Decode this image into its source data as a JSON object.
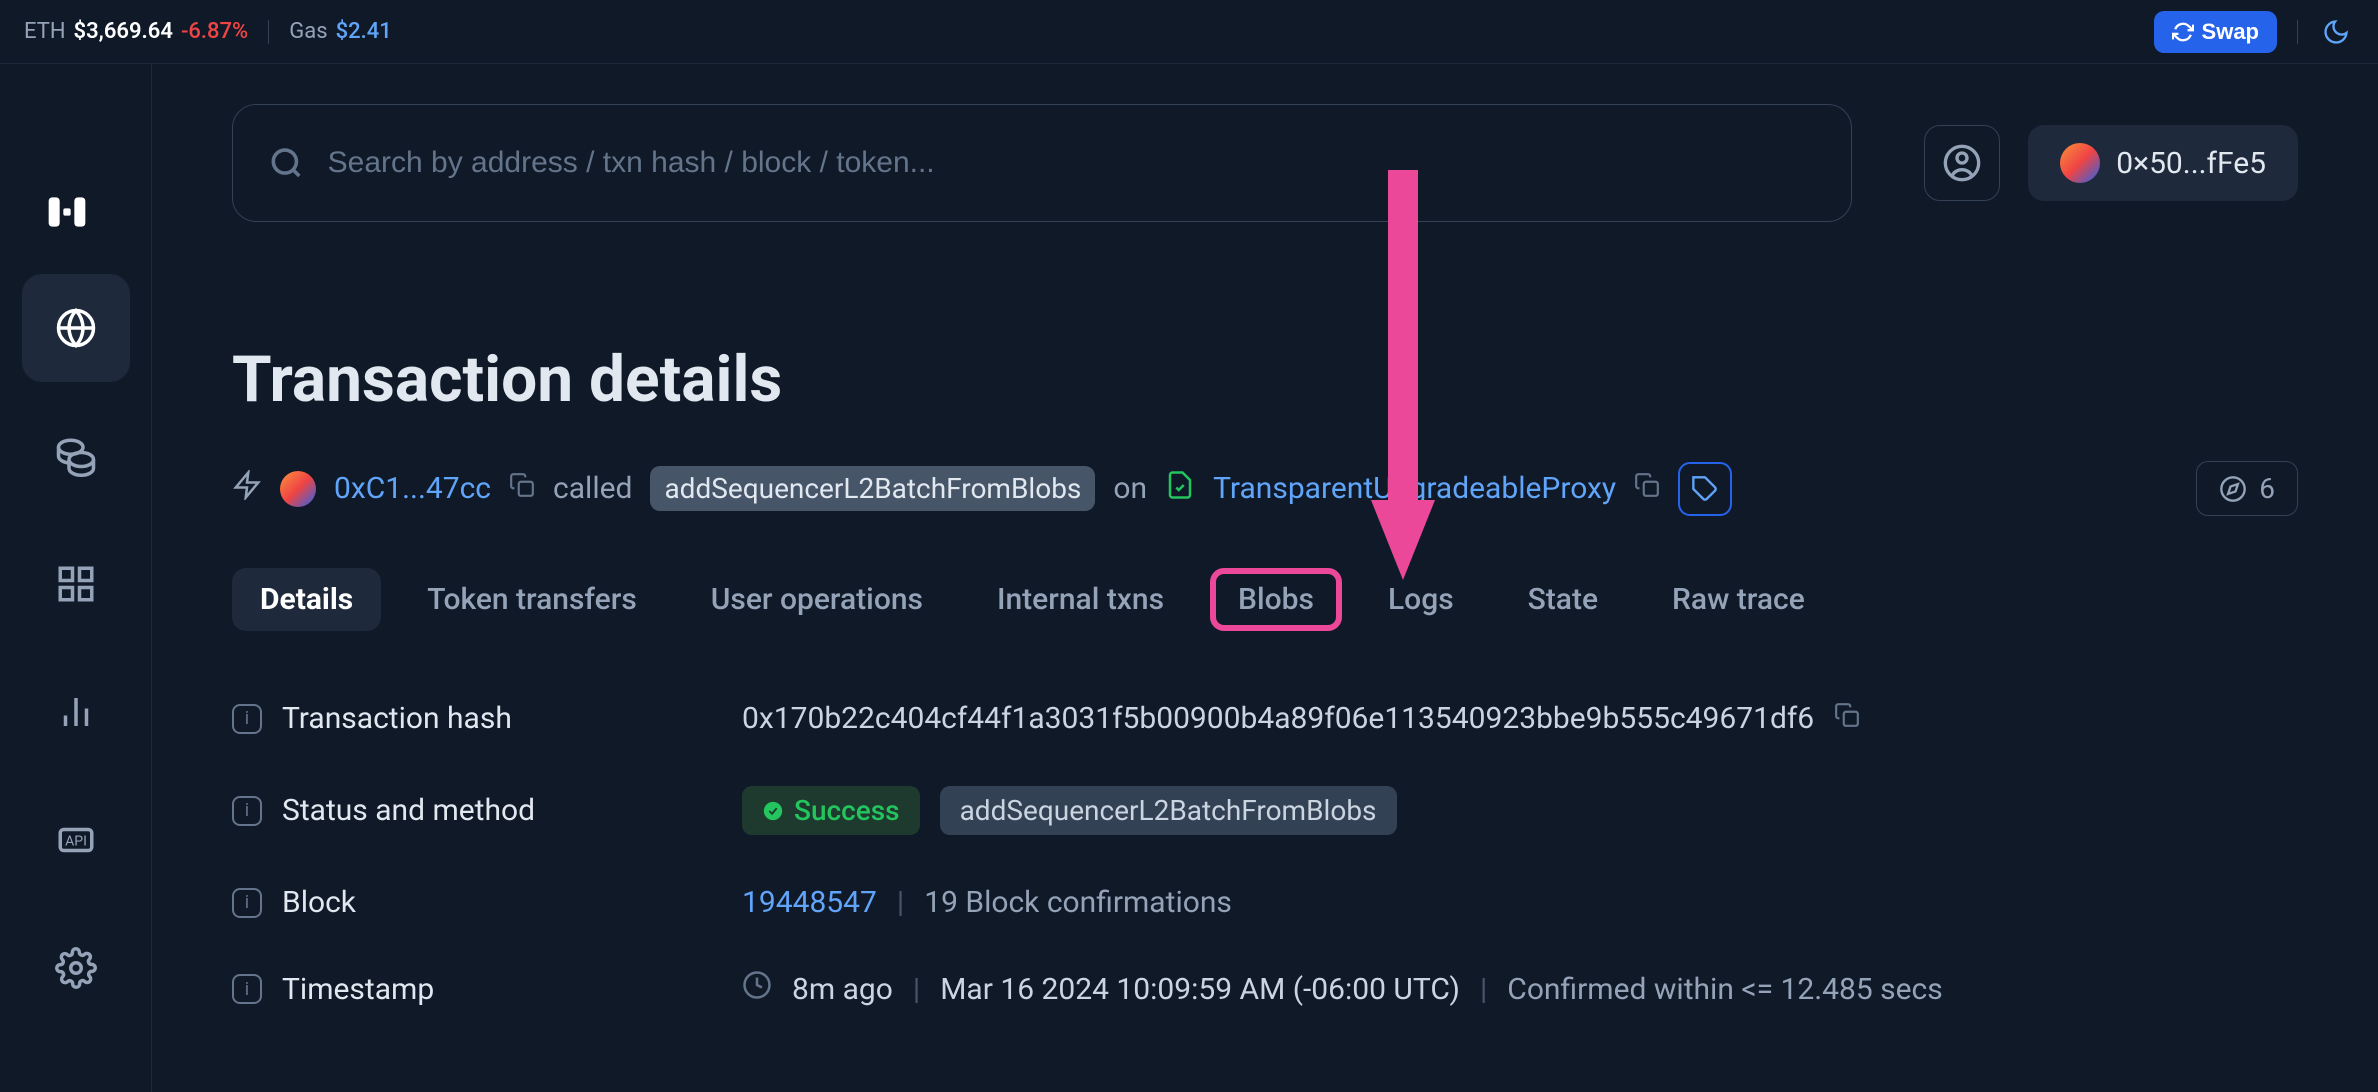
{
  "topbar": {
    "eth_label": "ETH",
    "eth_price": "$3,669.64",
    "eth_change": "-6.87%",
    "gas_label": "Gas",
    "gas_price": "$2.41",
    "swap_label": "Swap"
  },
  "search": {
    "placeholder": "Search by address / txn hash / block / token..."
  },
  "wallet": {
    "address": "0×50...fFe5"
  },
  "page": {
    "title": "Transaction details"
  },
  "summary": {
    "from_address": "0xC1...47cc",
    "called_label": "called",
    "method": "addSequencerL2BatchFromBlobs",
    "on_label": "on",
    "contract": "TransparentUpgradeableProxy",
    "counter": "6"
  },
  "tabs": [
    {
      "label": "Details",
      "active": true
    },
    {
      "label": "Token transfers"
    },
    {
      "label": "User operations"
    },
    {
      "label": "Internal txns"
    },
    {
      "label": "Blobs",
      "highlighted": true
    },
    {
      "label": "Logs"
    },
    {
      "label": "State"
    },
    {
      "label": "Raw trace"
    }
  ],
  "details": {
    "tx_hash_label": "Transaction hash",
    "tx_hash": "0x170b22c404cf44f1a3031f5b00900b4a89f06e113540923bbe9b555c49671df6",
    "status_label": "Status and method",
    "status_value": "Success",
    "status_method": "addSequencerL2BatchFromBlobs",
    "block_label": "Block",
    "block_number": "19448547",
    "block_confirmations": "19 Block confirmations",
    "timestamp_label": "Timestamp",
    "timestamp_ago": "8m ago",
    "timestamp_full": "Mar 16 2024 10:09:59 AM (-06:00 UTC)",
    "timestamp_confirmed": "Confirmed within <= 12.485 secs"
  }
}
